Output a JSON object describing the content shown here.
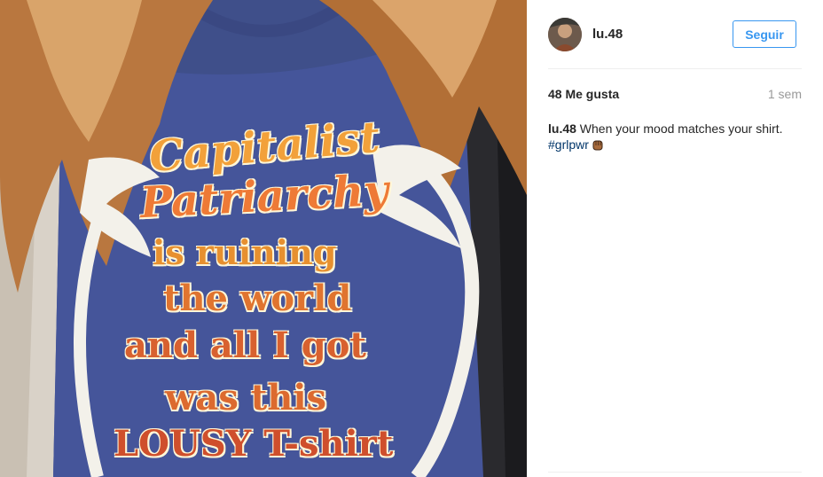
{
  "post": {
    "shirt_lines": [
      "Capitalist",
      "Patriarchy",
      "is ruining",
      "the world",
      "and all I got",
      "was this",
      "LOUSY T-shirt"
    ]
  },
  "header": {
    "username": "lu.48",
    "follow_label": "Seguir"
  },
  "meta": {
    "likes": "48 Me gusta",
    "time": "1 sem"
  },
  "caption": {
    "username": "lu.48",
    "text": " When your mood matches your shirt.",
    "hashtag": "#grlpwr",
    "emoji_icon": "raised-fist-icon"
  },
  "colors": {
    "accent": "#3897f0",
    "hashtag": "#003569",
    "muted": "#999999",
    "shirt": "#3f4f8a"
  }
}
